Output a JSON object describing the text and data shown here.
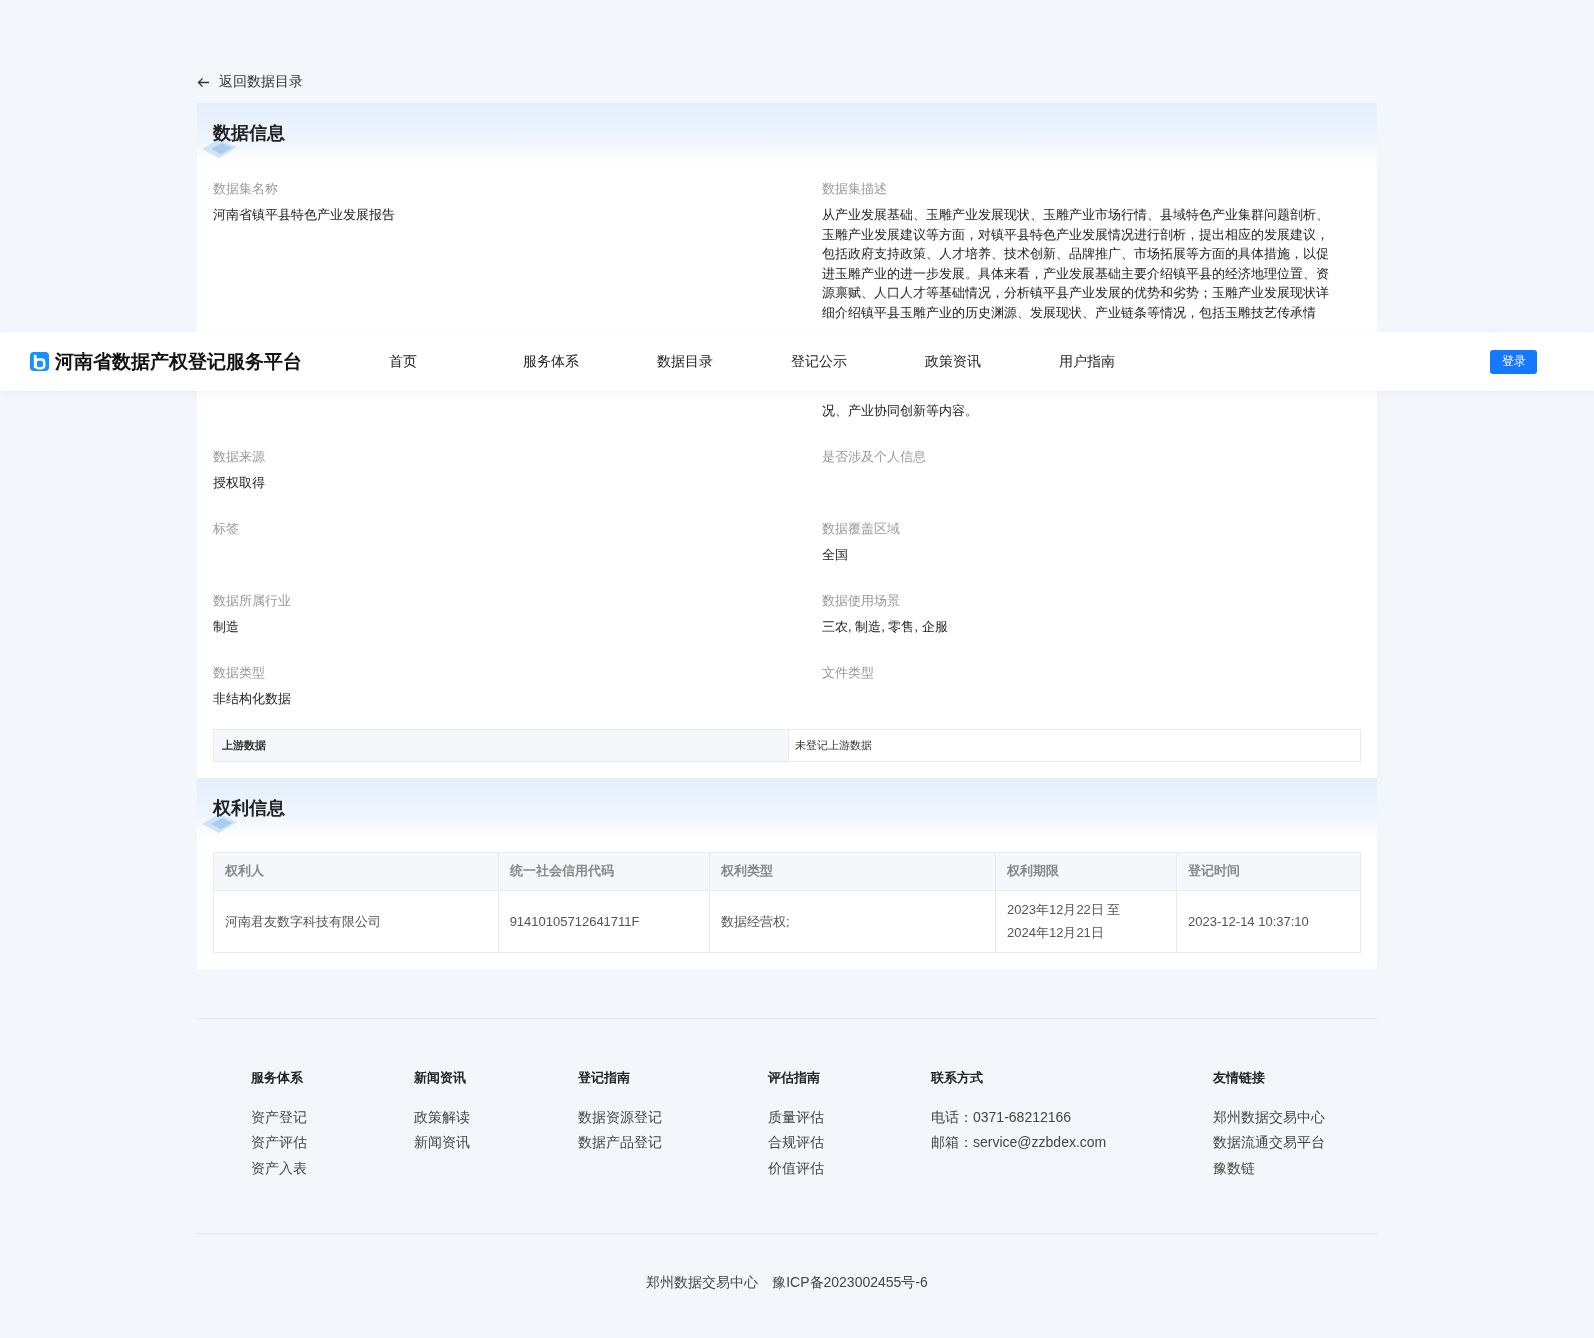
{
  "header": {
    "title": "河南省数据产权登记服务平台",
    "nav": [
      {
        "label": "首页",
        "selected": false
      },
      {
        "label": "服务体系",
        "selected": false
      },
      {
        "label": "数据目录",
        "selected": false
      },
      {
        "label": "登记公示",
        "selected": false
      },
      {
        "label": "政策资讯",
        "selected": false
      },
      {
        "label": "用户指南",
        "selected": false
      }
    ],
    "login": "登录"
  },
  "back_link": "返回数据目录",
  "data_info": {
    "title": "数据信息",
    "name": {
      "label": "数据集名称",
      "value": "河南省镇平县特色产业发展报告"
    },
    "description": {
      "label": "数据集描述",
      "lines_above": [
        "从产业发展基础、玉雕产业发展现状、玉雕产业市场行情、县域特色产业集群问题剖析、",
        "玉雕产业发展建议等方面，对镇平县特色产业发展情况进行剖析，提出相应的发展建议，",
        "包括政府支持政策、人才培养、技术创新、品牌推广、市场拓展等方面的具体措施，以促",
        "进玉雕产业的进一步发展。具体来看，产业发展基础主要介绍镇平县的经济地理位置、资",
        "源禀赋、人口人才等基础情况，分析镇平县产业发展的优势和劣势；玉雕产业发展现状详",
        "细介绍镇平县玉雕产业的历史渊源、发展现状、产业链条等情况，包括玉雕技艺传承情"
      ],
      "lines_below": [
        "况、产业协同创新等内容。"
      ]
    },
    "fields": [
      {
        "label": "数据来源",
        "value": "授权取得"
      },
      {
        "label": "是否涉及个人信息"
      },
      {
        "label": "标签"
      },
      {
        "label": "数据覆盖区域",
        "value": "全国"
      },
      {
        "label": "数据所属行业",
        "value": "制造"
      },
      {
        "label": "数据使用场景",
        "value": "三农, 制造, 零售, 企服"
      },
      {
        "label": "数据类型",
        "value": "非结构化数据"
      },
      {
        "label": "文件类型"
      }
    ],
    "upstream": {
      "label": "上游数据",
      "value": "未登记上游数据"
    }
  },
  "rights_info": {
    "title": "权利信息",
    "columns": [
      "权利人",
      "统一社会信用代码",
      "权利类型",
      "权利期限",
      "登记时间"
    ],
    "rows": [
      [
        "河南君友数字科技有限公司",
        "91410105712641711F",
        "数据经营权;",
        "2023年12月22日 至 2024年12月21日",
        "2023-12-14 10:37:10"
      ]
    ]
  },
  "footer": {
    "columns": [
      {
        "title": "服务体系",
        "links": [
          "资产登记",
          "资产评估",
          "资产入表"
        ]
      },
      {
        "title": "新闻资讯",
        "links": [
          "政策解读",
          "新闻资讯"
        ]
      },
      {
        "title": "登记指南",
        "links": [
          "数据资源登记",
          "数据产品登记"
        ]
      },
      {
        "title": "评估指南",
        "links": [
          "质量评估",
          "合规评估",
          "价值评估"
        ]
      },
      {
        "title": "联系方式",
        "links": [
          "电话：0371-68212166",
          "邮箱：service@zzbdex.com"
        ]
      },
      {
        "title": "友情链接",
        "links": [
          "郑州数据交易中心",
          "数据流通交易平台",
          "豫数链"
        ]
      }
    ],
    "copyright": [
      "郑州数据交易中心",
      "豫ICP备2023002455号-6"
    ]
  }
}
